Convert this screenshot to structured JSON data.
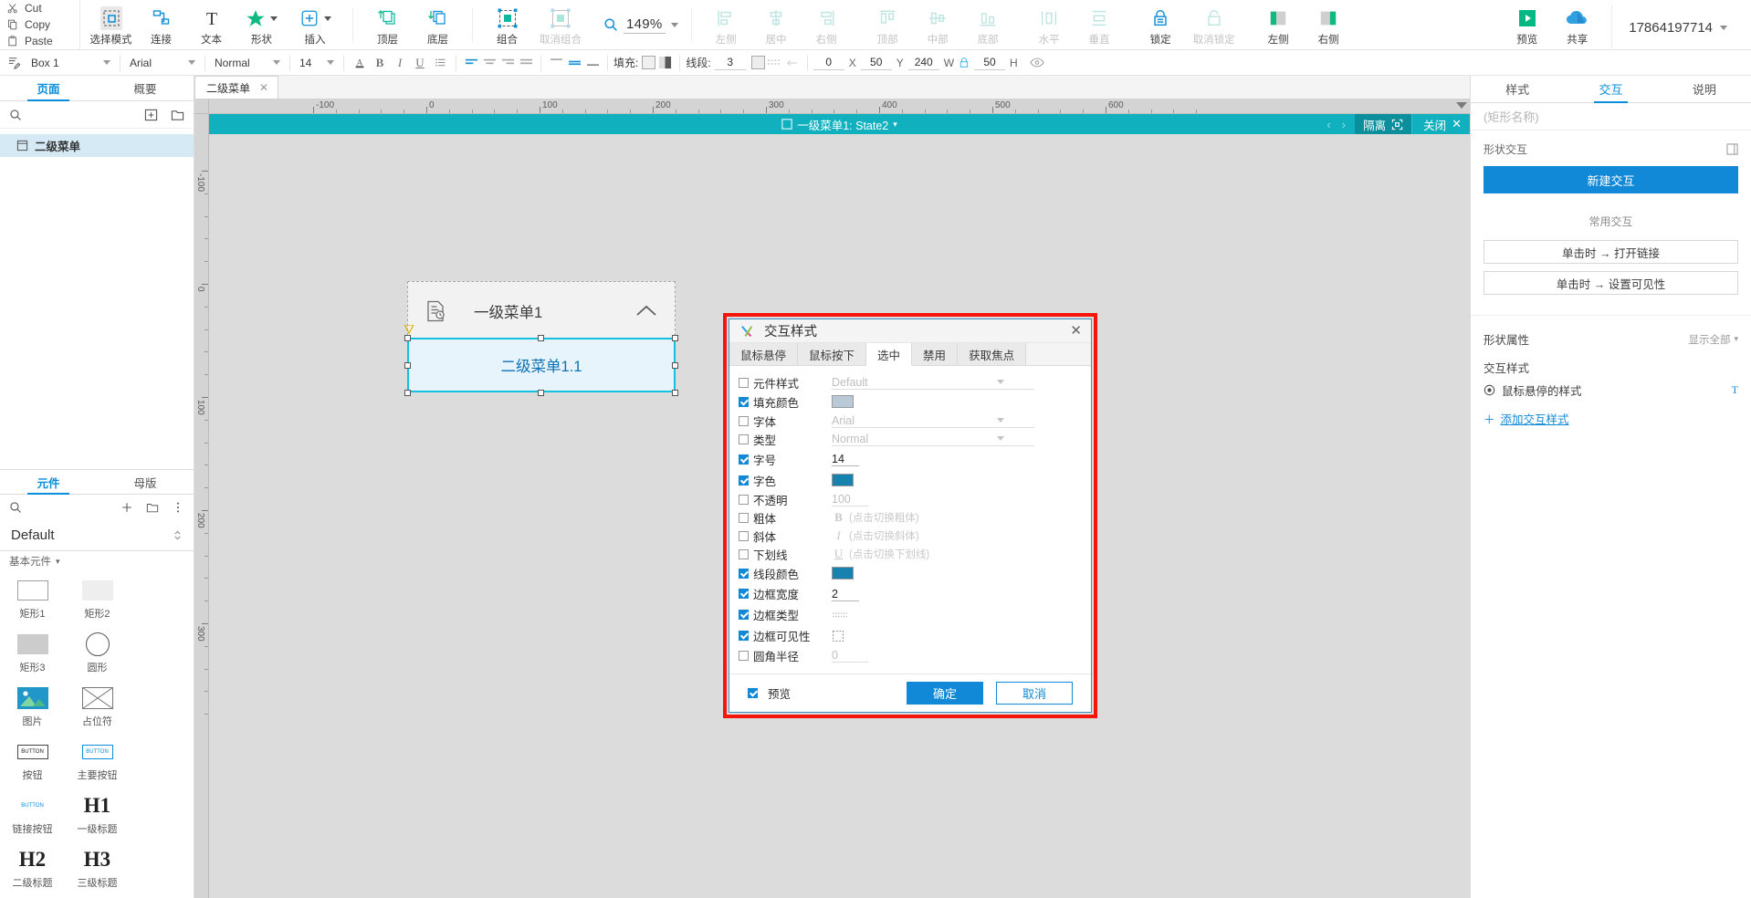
{
  "clipboard": {
    "cut": "Cut",
    "copy": "Copy",
    "paste": "Paste"
  },
  "toolbar": {
    "items": [
      {
        "label": "选择模式",
        "icon": "select-mode-icon",
        "selected": true
      },
      {
        "label": "连接",
        "icon": "connect-icon"
      },
      {
        "label": "文本",
        "icon": "text-icon"
      },
      {
        "label": "形状",
        "icon": "shape-icon",
        "caret": true
      },
      {
        "label": "插入",
        "icon": "insert-icon",
        "caret": true
      },
      {
        "label": "顶层",
        "icon": "bring-front-icon"
      },
      {
        "label": "底层",
        "icon": "send-back-icon"
      },
      {
        "label": "组合",
        "icon": "group-icon"
      },
      {
        "label": "取消组合",
        "icon": "ungroup-icon",
        "disabled": true
      }
    ],
    "zoom": "149%",
    "align": [
      {
        "label": "左侧",
        "icon": "align-left-icon",
        "disabled": true
      },
      {
        "label": "居中",
        "icon": "align-center-icon",
        "disabled": true
      },
      {
        "label": "右侧",
        "icon": "align-right-icon",
        "disabled": true
      }
    ],
    "valign": [
      {
        "label": "顶部",
        "icon": "align-top-icon",
        "disabled": true
      },
      {
        "label": "中部",
        "icon": "align-middle-icon",
        "disabled": true
      },
      {
        "label": "底部",
        "icon": "align-bottom-icon",
        "disabled": true
      }
    ],
    "distribute": [
      {
        "label": "水平",
        "icon": "distribute-h-icon",
        "disabled": true
      },
      {
        "label": "垂直",
        "icon": "distribute-v-icon",
        "disabled": true
      }
    ],
    "lock": [
      {
        "label": "锁定",
        "icon": "lock-icon"
      },
      {
        "label": "取消锁定",
        "icon": "unlock-icon",
        "disabled": true
      }
    ],
    "sidebars": [
      {
        "label": "左侧",
        "icon": "panel-left-icon"
      },
      {
        "label": "右侧",
        "icon": "panel-right-icon"
      }
    ],
    "preview": {
      "label": "预览",
      "icon": "play-icon"
    },
    "share": {
      "label": "共享",
      "icon": "cloud-icon"
    },
    "account": "17864197714"
  },
  "props": {
    "selection": "Box 1",
    "font_family": "Arial",
    "font_style": "Normal",
    "font_size": "14",
    "fill_label": "填充:",
    "line_label": "线段:",
    "line_width": "3",
    "x": "0",
    "x_label": "X",
    "y": "50",
    "y_label": "Y",
    "w": "240",
    "w_label": "W",
    "h": "50",
    "h_label": "H"
  },
  "left_panel": {
    "tabs": [
      {
        "label": "页面",
        "active": true
      },
      {
        "label": "概要",
        "active": false
      }
    ],
    "pages": [
      {
        "label": "二级菜单",
        "active": true
      }
    ],
    "library_tabs": [
      {
        "label": "元件",
        "active": true
      },
      {
        "label": "母版",
        "active": false
      }
    ],
    "library_name": "Default",
    "library_category": "基本元件",
    "widgets": [
      {
        "label": "矩形1",
        "icon": "rect-outline-icon"
      },
      {
        "label": "矩形2",
        "icon": "rect-light-icon"
      },
      {
        "label": "矩形3",
        "icon": "rect-gray-icon"
      },
      {
        "label": "圆形",
        "icon": "circle-icon"
      },
      {
        "label": "图片",
        "icon": "image-icon"
      },
      {
        "label": "占位符",
        "icon": "placeholder-icon"
      },
      {
        "label": "按钮",
        "icon": "button-icon"
      },
      {
        "label": "主要按钮",
        "icon": "primary-button-icon"
      },
      {
        "label": "链接按钮",
        "icon": "link-button-icon"
      },
      {
        "label": "一级标题",
        "icon": "h1-icon",
        "glyph": "H1"
      },
      {
        "label": "二级标题",
        "icon": "h2-icon",
        "glyph": "H2"
      },
      {
        "label": "三级标题",
        "icon": "h3-icon",
        "glyph": "H3"
      }
    ]
  },
  "canvas": {
    "tab": "二级菜单",
    "isolation": {
      "title": "一级菜单1: State2",
      "isolate": "隔离",
      "close": "关闭"
    },
    "ruler_h_labels": [
      "-100",
      "0",
      "100",
      "200",
      "300",
      "400",
      "500",
      "600"
    ],
    "ruler_v_labels": [
      "-100",
      "0",
      "100",
      "200",
      "300"
    ],
    "menu_item": "一级菜单1",
    "sub_item": "二级菜单1.1"
  },
  "right_panel": {
    "tabs": [
      {
        "label": "样式",
        "active": false
      },
      {
        "label": "交互",
        "active": true
      },
      {
        "label": "说明",
        "active": false
      }
    ],
    "name_placeholder": "(矩形名称)",
    "shape_interaction_label": "形状交互",
    "new_interaction": "新建交互",
    "common_label": "常用交互",
    "common_items": [
      "单击时 → 打开链接",
      "单击时 → 设置可见性"
    ],
    "shape_props_label": "形状属性",
    "show_all": "显示全部",
    "interaction_style_label": "交互样式",
    "hover_style": "鼠标悬停的样式",
    "add_style": "添加交互样式"
  },
  "modal": {
    "title": "交互样式",
    "tabs": [
      {
        "label": "鼠标悬停",
        "active": false
      },
      {
        "label": "鼠标按下",
        "active": false
      },
      {
        "label": "选中",
        "active": true
      },
      {
        "label": "禁用",
        "active": false
      },
      {
        "label": "获取焦点",
        "active": false
      }
    ],
    "rows": [
      {
        "label": "元件样式",
        "checked": false,
        "kind": "ghost-select",
        "value": "Default"
      },
      {
        "label": "填充颜色",
        "checked": true,
        "kind": "swatch",
        "color": "#b9c9d8"
      },
      {
        "label": "字体",
        "checked": false,
        "kind": "ghost-select",
        "value": "Arial"
      },
      {
        "label": "类型",
        "checked": false,
        "kind": "ghost-select",
        "value": "Normal"
      },
      {
        "label": "字号",
        "checked": true,
        "kind": "number",
        "value": "14"
      },
      {
        "label": "字色",
        "checked": true,
        "kind": "swatch",
        "color": "#1682ad"
      },
      {
        "label": "不透明",
        "checked": false,
        "kind": "ghost-number",
        "value": "100"
      },
      {
        "label": "粗体",
        "checked": false,
        "kind": "toggle",
        "glyph": "B",
        "note": "(点击切换粗体)"
      },
      {
        "label": "斜体",
        "checked": false,
        "kind": "toggle",
        "glyph": "I",
        "note": "(点击切换斜体)"
      },
      {
        "label": "下划线",
        "checked": false,
        "kind": "toggle",
        "glyph": "U",
        "note": "(点击切换下划线)"
      },
      {
        "label": "线段颜色",
        "checked": true,
        "kind": "swatch",
        "color": "#1682ad"
      },
      {
        "label": "边框宽度",
        "checked": true,
        "kind": "number",
        "value": "2"
      },
      {
        "label": "边框类型",
        "checked": true,
        "kind": "icon",
        "glyph": "dotted"
      },
      {
        "label": "边框可见性",
        "checked": true,
        "kind": "icon",
        "glyph": "box"
      },
      {
        "label": "圆角半径",
        "checked": false,
        "kind": "ghost-number",
        "value": "0"
      }
    ],
    "preview_label": "预览",
    "preview_checked": true,
    "ok": "确定",
    "cancel": "取消"
  }
}
